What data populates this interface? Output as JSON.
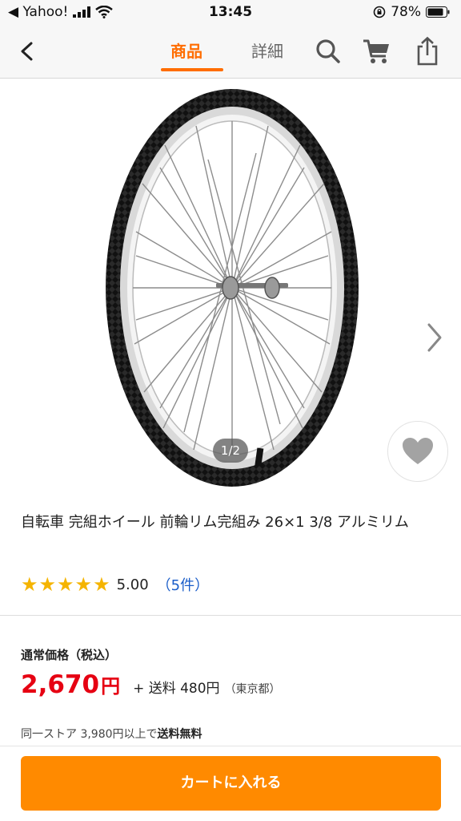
{
  "status_bar": {
    "carrier": "◀ Yahoo!",
    "time": "13:45",
    "battery": "78%"
  },
  "nav": {
    "tabs": [
      {
        "label": "商品",
        "active": true
      },
      {
        "label": "詳細",
        "active": false
      }
    ],
    "icons": [
      "back-icon",
      "search-icon",
      "cart-icon",
      "share-icon"
    ],
    "accent_color": "#ff6d00"
  },
  "gallery": {
    "page_indicator": "1/2",
    "icons": [
      "chevron-right-icon",
      "heart-icon"
    ]
  },
  "product": {
    "title": "自転車 完組ホイール 前輪リム完組み 26×1 3/8 アルミリム",
    "rating": {
      "stars": 5,
      "score": "5.00",
      "count": "（5件）"
    }
  },
  "price": {
    "label": "通常価格（税込）",
    "value": "2,670",
    "currency": "円",
    "shipping": "+ 送料 480円",
    "shipping_region": "（東京都）",
    "price_color": "#e60012"
  },
  "free_shipping": {
    "prefix": "同一ストア 3,980円以上で",
    "highlight": "送料無料"
  },
  "cart": {
    "button_label": "カートに入れる",
    "button_color": "#ff8a00"
  }
}
